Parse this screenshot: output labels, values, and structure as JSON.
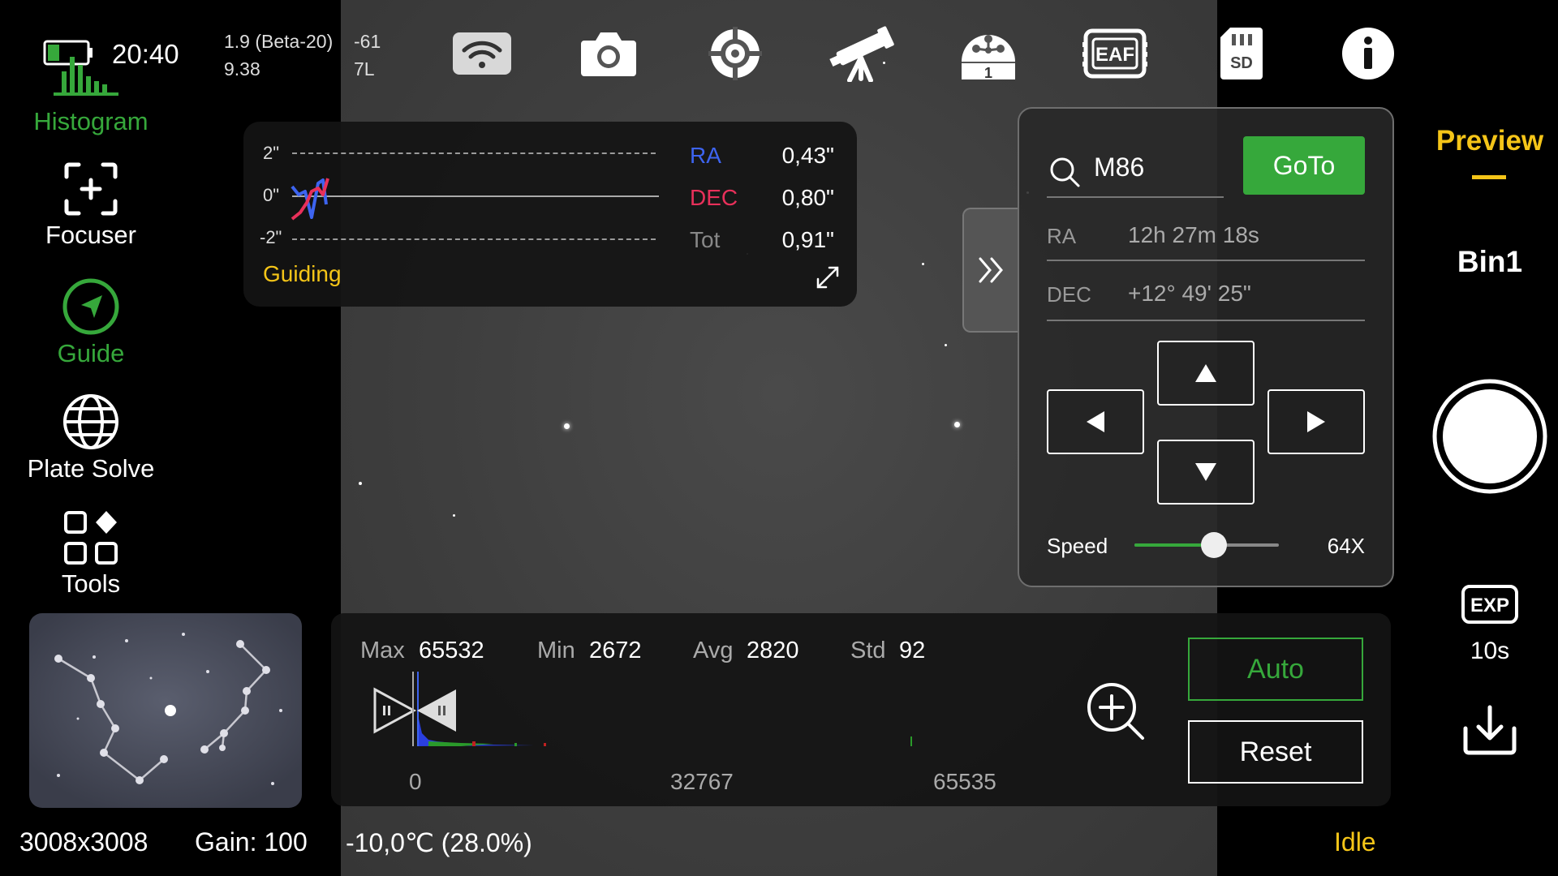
{
  "status": {
    "time": "20:40",
    "version": "1.9 (Beta-20)",
    "version_sub": "9.38",
    "signal": "-61",
    "signal_sub": "7L"
  },
  "nav": {
    "histogram": "Histogram",
    "focuser": "Focuser",
    "guide": "Guide",
    "plate_solve": "Plate Solve",
    "tools": "Tools"
  },
  "top_icons": [
    "wifi-icon",
    "camera-icon",
    "crosshair-icon",
    "telescope-icon",
    "filter-wheel-icon",
    "eaf-icon",
    "sd-card-icon",
    "info-icon"
  ],
  "top_icon_text": {
    "filter_slot": "1",
    "eaf": "EAF",
    "sd": "SD"
  },
  "guiding": {
    "title": "Guiding",
    "y_top": "2\"",
    "y_mid": "0\"",
    "y_bot": "-2\"",
    "ra_label": "RA",
    "ra_value": "0,43\"",
    "dec_label": "DEC",
    "dec_value": "0,80\"",
    "tot_label": "Tot",
    "tot_value": "0,91\"",
    "colors": {
      "ra": "#3d64f0",
      "dec": "#e8305a",
      "title": "#f5c518"
    }
  },
  "goto": {
    "search_value": "M86",
    "goto_label": "GoTo",
    "ra_label": "RA",
    "ra_value": "12h 27m 18s",
    "dec_label": "DEC",
    "dec_value": "+12° 49' 25\"",
    "speed_label": "Speed",
    "speed_value": "64X",
    "speed_fraction": 0.55,
    "accent": "#36a83b"
  },
  "histogram": {
    "max_label": "Max",
    "max_value": "65532",
    "min_label": "Min",
    "min_value": "2672",
    "avg_label": "Avg",
    "avg_value": "2820",
    "std_label": "Std",
    "std_value": "92",
    "axis_0": "0",
    "axis_mid": "32767",
    "axis_max": "65535",
    "auto_label": "Auto",
    "reset_label": "Reset"
  },
  "right": {
    "preview": "Preview",
    "bin": "Bin1",
    "exp_icon_text": "EXP",
    "exposure": "10s"
  },
  "bottom": {
    "resolution": "3008x3008",
    "gain": "Gain: 100",
    "temperature": "-10,0℃  (28.0%)",
    "state": "Idle"
  }
}
